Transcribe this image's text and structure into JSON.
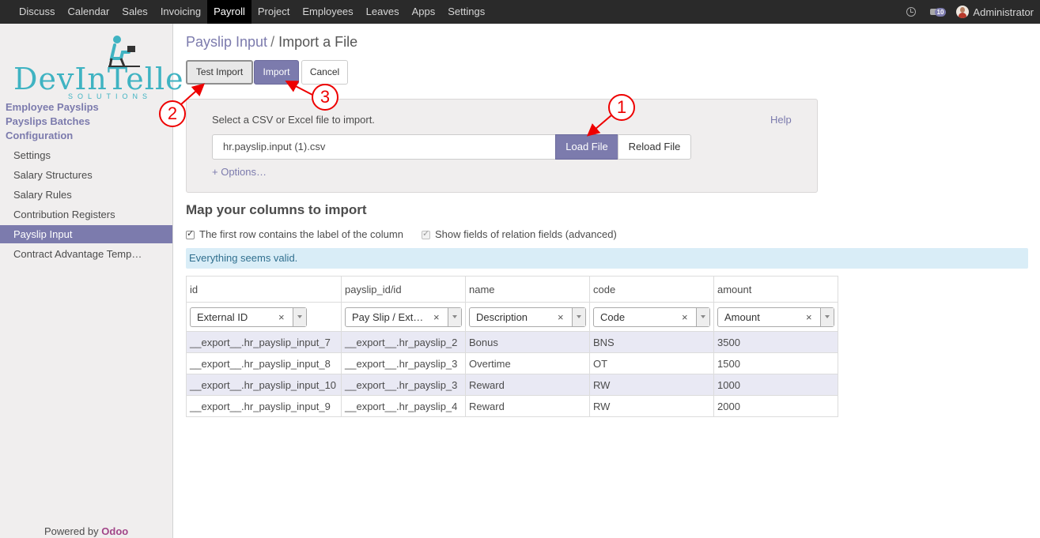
{
  "topbar": {
    "menu": [
      "Discuss",
      "Calendar",
      "Sales",
      "Invoicing",
      "Payroll",
      "Project",
      "Employees",
      "Leaves",
      "Apps",
      "Settings"
    ],
    "active": "Payroll",
    "chat_count": "10",
    "user": "Administrator"
  },
  "sidebar": {
    "logo_text": "DevInTelle",
    "logo_tagline": "SOLUTIONS",
    "sections": [
      "Employee Payslips",
      "Payslips Batches",
      "Configuration"
    ],
    "items": [
      "Settings",
      "Salary Structures",
      "Salary Rules",
      "Contribution Registers",
      "Payslip Input",
      "Contract Advantage Temp…"
    ],
    "active_item": "Payslip Input",
    "powered_by": "Powered by",
    "powered_brand": "Odoo"
  },
  "breadcrumb": {
    "parent": "Payslip Input",
    "separator": "/",
    "current": "Import a File"
  },
  "buttons": {
    "test_import": "Test Import",
    "import": "Import",
    "cancel": "Cancel"
  },
  "loader": {
    "prompt": "Select a CSV or Excel file to import.",
    "help": "Help",
    "file_name": "hr.payslip.input (1).csv",
    "load_file": "Load File",
    "reload_file": "Reload File",
    "options": "+ Options…"
  },
  "mapping": {
    "title": "Map your columns to import",
    "first_row_label": "The first row contains the label of the column",
    "first_row_checked": true,
    "relation_fields_label": "Show fields of relation fields (advanced)",
    "relation_fields_checked": true,
    "status": "Everything seems valid."
  },
  "table": {
    "columns": [
      "id",
      "payslip_id/id",
      "name",
      "code",
      "amount"
    ],
    "field_selects": [
      "External ID",
      "Pay Slip / Ext…",
      "Description",
      "Code",
      "Amount"
    ],
    "rows": [
      [
        "__export__.hr_payslip_input_7",
        "__export__.hr_payslip_2",
        "Bonus",
        "BNS",
        "3500"
      ],
      [
        "__export__.hr_payslip_input_8",
        "__export__.hr_payslip_3",
        "Overtime",
        "OT",
        "1500"
      ],
      [
        "__export__.hr_payslip_input_10",
        "__export__.hr_payslip_3",
        "Reward",
        "RW",
        "1000"
      ],
      [
        "__export__.hr_payslip_input_9",
        "__export__.hr_payslip_4",
        "Reward",
        "RW",
        "2000"
      ]
    ]
  },
  "annotations": {
    "numbers": [
      "1",
      "2",
      "3"
    ],
    "color": "#e00000"
  },
  "colors": {
    "accent": "#7c7bad",
    "topbar": "#2a2a2a",
    "valid_bg": "#d9edf7",
    "logo": "#3fb3c2"
  }
}
